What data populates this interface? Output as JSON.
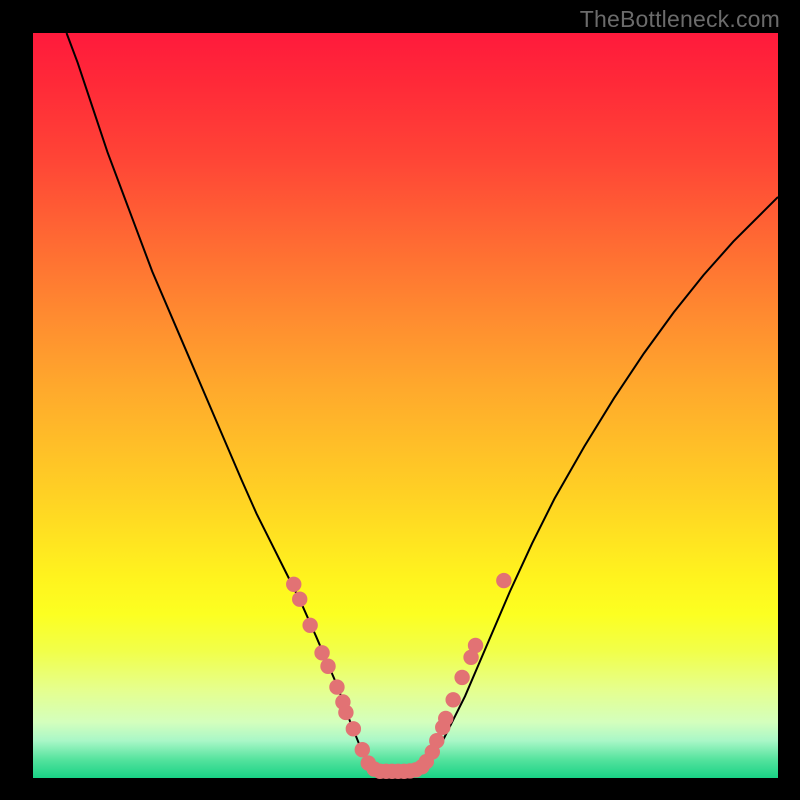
{
  "watermark": "TheBottleneck.com",
  "colors": {
    "curve_stroke": "#000000",
    "marker_fill": "#e27274",
    "marker_stroke": "#e27274"
  },
  "chart_data": {
    "type": "line",
    "title": "",
    "xlabel": "",
    "ylabel": "",
    "xlim": [
      0,
      100
    ],
    "ylim": [
      0,
      100
    ],
    "series": [
      {
        "name": "curve",
        "x": [
          4.5,
          6,
          8,
          10,
          13,
          16,
          19,
          22,
          25,
          28,
          30,
          32,
          34,
          36,
          38,
          39.5,
          41,
          42,
          43,
          44,
          45,
          46,
          47,
          48.5,
          50,
          51.5,
          53,
          55,
          58,
          61,
          64,
          67,
          70,
          74,
          78,
          82,
          86,
          90,
          94,
          98,
          100
        ],
        "y": [
          100,
          96,
          90,
          84,
          76,
          68,
          61,
          54,
          47,
          40,
          35.5,
          31.5,
          27.5,
          23.5,
          19,
          15.5,
          12,
          9,
          6.5,
          4,
          2.2,
          1.2,
          0.9,
          0.9,
          0.9,
          1.1,
          2,
          5,
          11,
          18,
          25,
          31.5,
          37.5,
          44.5,
          51,
          57,
          62.5,
          67.5,
          72,
          76,
          78
        ]
      }
    ],
    "markers": [
      {
        "x": 35.0,
        "y": 26.0
      },
      {
        "x": 35.8,
        "y": 24.0
      },
      {
        "x": 37.2,
        "y": 20.5
      },
      {
        "x": 38.8,
        "y": 16.8
      },
      {
        "x": 39.6,
        "y": 15.0
      },
      {
        "x": 40.8,
        "y": 12.2
      },
      {
        "x": 41.6,
        "y": 10.2
      },
      {
        "x": 42.0,
        "y": 8.8
      },
      {
        "x": 43.0,
        "y": 6.6
      },
      {
        "x": 44.2,
        "y": 3.8
      },
      {
        "x": 45.0,
        "y": 2.0
      },
      {
        "x": 45.8,
        "y": 1.2
      },
      {
        "x": 46.6,
        "y": 0.9
      },
      {
        "x": 47.4,
        "y": 0.9
      },
      {
        "x": 48.2,
        "y": 0.9
      },
      {
        "x": 49.0,
        "y": 0.9
      },
      {
        "x": 49.8,
        "y": 0.9
      },
      {
        "x": 50.6,
        "y": 0.95
      },
      {
        "x": 51.4,
        "y": 1.1
      },
      {
        "x": 52.2,
        "y": 1.5
      },
      {
        "x": 52.8,
        "y": 2.2
      },
      {
        "x": 53.6,
        "y": 3.5
      },
      {
        "x": 54.2,
        "y": 5.0
      },
      {
        "x": 55.0,
        "y": 6.8
      },
      {
        "x": 55.4,
        "y": 8.0
      },
      {
        "x": 56.4,
        "y": 10.5
      },
      {
        "x": 57.6,
        "y": 13.5
      },
      {
        "x": 58.8,
        "y": 16.2
      },
      {
        "x": 59.4,
        "y": 17.8
      },
      {
        "x": 63.2,
        "y": 26.5
      }
    ],
    "marker_radius_px": 7.2
  }
}
